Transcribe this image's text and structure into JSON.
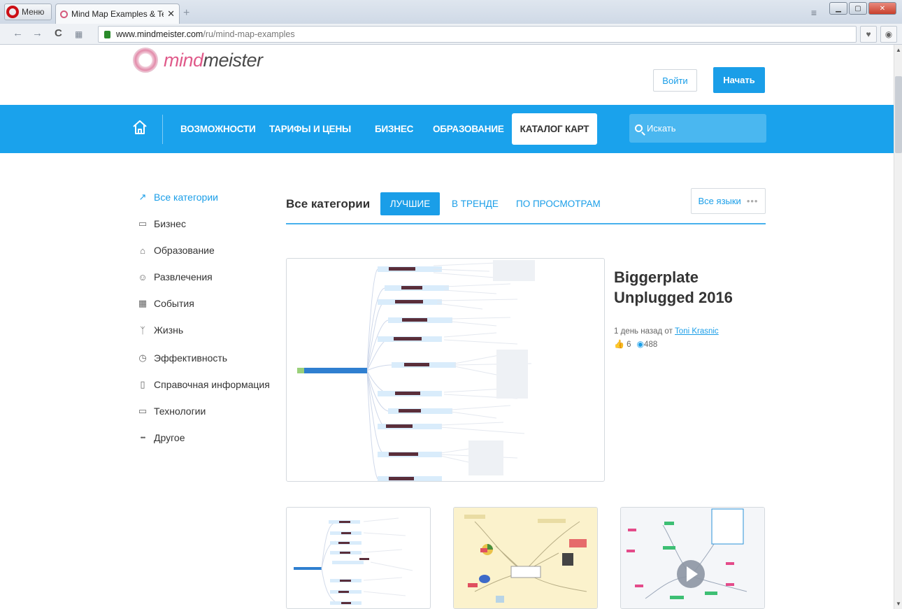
{
  "browser": {
    "menu_label": "Меню",
    "tab_title": "Mind Map Examples & Te",
    "tab_close": "✕",
    "new_tab": "+",
    "url_host": "www.mindmeister.com",
    "url_path": "/ru/mind-map-examples"
  },
  "header": {
    "logo_text_mind": "mind",
    "logo_text_meister": "meister",
    "login_label": "Войти",
    "start_label": "Начать"
  },
  "nav": {
    "items": [
      "ВОЗМОЖНОСТИ",
      "ТАРИФЫ И ЦЕНЫ",
      "БИЗНЕС",
      "ОБРАЗОВАНИЕ"
    ],
    "active_label": "КАТАЛОГ КАРТ",
    "search_placeholder": "Искать"
  },
  "sidebar": {
    "items": [
      {
        "label": "Все категории",
        "icon": "trend-icon",
        "glyph": "↗"
      },
      {
        "label": "Бизнес",
        "icon": "briefcase-icon",
        "glyph": "▭"
      },
      {
        "label": "Образование",
        "icon": "graduation-cap-icon",
        "glyph": "⌂"
      },
      {
        "label": "Развлечения",
        "icon": "mask-icon",
        "glyph": "☺"
      },
      {
        "label": "События",
        "icon": "calendar-icon",
        "glyph": "▦"
      },
      {
        "label": "Жизнь",
        "icon": "person-icon",
        "glyph": "ᛉ"
      },
      {
        "label": "Эффективность",
        "icon": "check-clock-icon",
        "glyph": "◷"
      },
      {
        "label": "Справочная информация",
        "icon": "book-icon",
        "glyph": "▯"
      },
      {
        "label": "Технологии",
        "icon": "laptop-icon",
        "glyph": "▭"
      },
      {
        "label": "Другое",
        "icon": "dots-icon",
        "glyph": "•••"
      }
    ]
  },
  "content": {
    "title": "Все категории",
    "tab_best": "ЛУЧШИЕ",
    "tab_trending": "В ТРЕНДЕ",
    "tab_views": "ПО ПРОСМОТРАМ",
    "lang_label": "Все языки",
    "lang_dots": "•••"
  },
  "featured": {
    "title": "Biggerplate Unplugged 2016",
    "meta_prefix": "1 день назад от",
    "author": "Toni Krasnic",
    "likes": "6",
    "views": "488"
  },
  "colors": {
    "brand_blue": "#1aa2ec",
    "link_blue": "#1a9ee8",
    "logo_pink": "#e05a8a"
  }
}
